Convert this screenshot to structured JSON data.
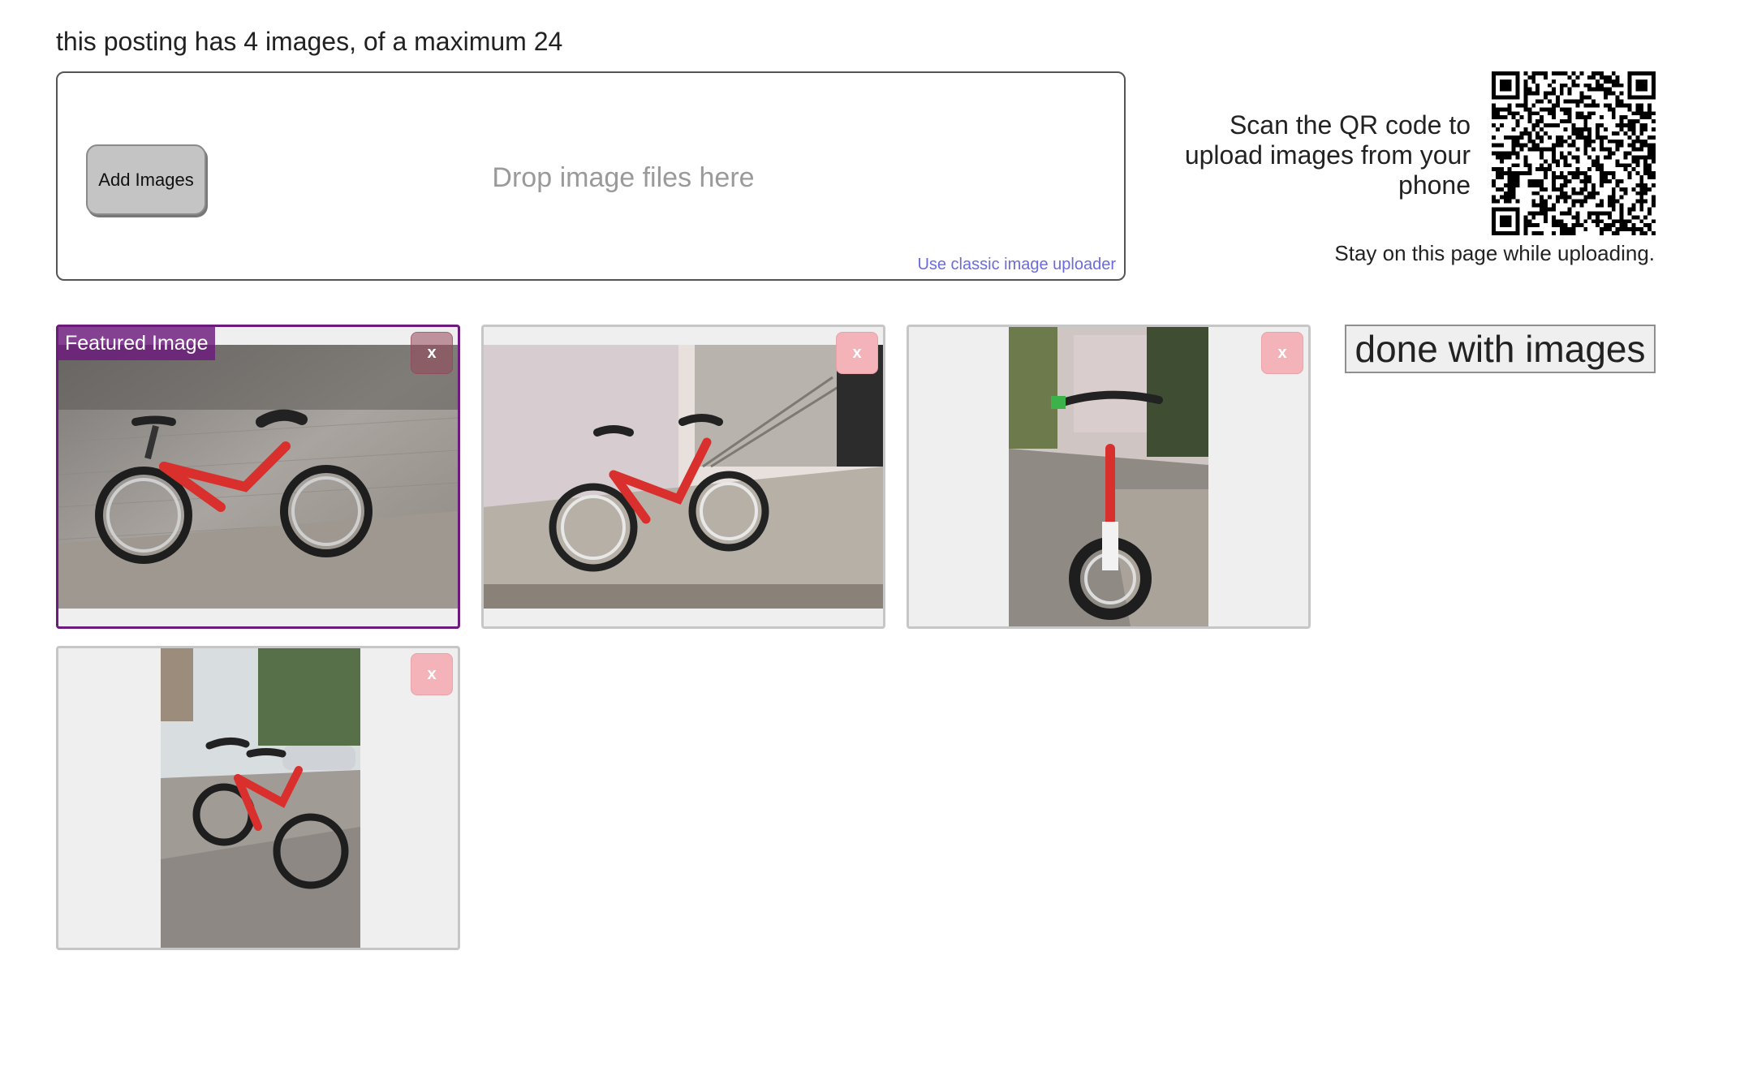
{
  "status": "this posting has 4 images, of a maximum 24",
  "uploader": {
    "add_label": "Add Images",
    "drop_text": "Drop image files here",
    "classic_link": "Use classic image uploader"
  },
  "qr": {
    "text": "Scan the QR code to upload images from your phone",
    "stay": "Stay on this page while uploading."
  },
  "images": [
    {
      "badge": "Featured Image",
      "remove": "x",
      "featured": true,
      "orientation": "landscape"
    },
    {
      "remove": "x",
      "orientation": "landscape"
    },
    {
      "remove": "x",
      "orientation": "portrait"
    },
    {
      "remove": "x",
      "orientation": "portrait"
    }
  ],
  "done_label": "done with images",
  "colors": {
    "featured_border": "#6d1a7d",
    "remove_button": "#f3b3b8",
    "link": "#6b6bdc"
  }
}
